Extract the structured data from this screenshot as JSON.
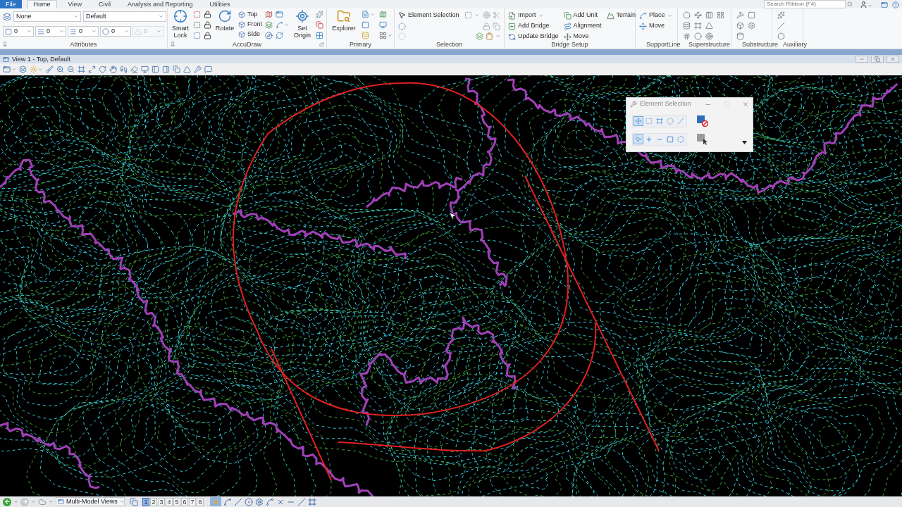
{
  "ribbon_tabs": [
    {
      "label": "File",
      "kind": "backstage",
      "selected": false
    },
    {
      "label": "Home",
      "kind": "tab",
      "selected": true
    },
    {
      "label": "View",
      "kind": "tab",
      "selected": false
    },
    {
      "label": "Civil",
      "kind": "tab",
      "selected": false
    },
    {
      "label": "Analysis and Reporting",
      "kind": "tab",
      "selected": false
    },
    {
      "label": "Utilities",
      "kind": "tab",
      "selected": false
    }
  ],
  "search": {
    "placeholder": "Search Ribbon (F4)"
  },
  "ribbon_groups": [
    {
      "kind": "attributes",
      "title": "Attributes",
      "dropdowns": [
        {
          "value": "None"
        },
        {
          "value": "Default"
        }
      ],
      "fields": [
        {
          "value": "0",
          "disabled": false
        },
        {
          "value": "0",
          "disabled": false
        },
        {
          "value": "0",
          "disabled": false
        },
        {
          "value": "0",
          "disabled": false
        },
        {
          "value": "0",
          "disabled": true
        }
      ]
    },
    {
      "kind": "accudraw",
      "title": "AccuDraw",
      "smart_lock": "Smart Lock",
      "rotate": "Rotate",
      "views": [
        "Top",
        "Front",
        "Side"
      ],
      "set_origin": "Set Origin"
    },
    {
      "kind": "primary",
      "title": "Primary",
      "explorer": "Explorer"
    },
    {
      "kind": "selection",
      "title": "Selection",
      "element_selection": "Element Selection"
    },
    {
      "kind": "bridge_setup",
      "title": "Bridge Setup",
      "columns": [
        {
          "commands": [
            {
              "label": "Import",
              "dropdown": true
            },
            {
              "label": "Add Bridge",
              "dropdown": false
            },
            {
              "label": "Update Bridge",
              "dropdown": false
            }
          ]
        },
        {
          "commands": [
            {
              "label": "Add Unit",
              "dropdown": false
            },
            {
              "label": "Alignment",
              "dropdown": false
            },
            {
              "label": "Move",
              "dropdown": false
            }
          ]
        },
        {
          "commands": [
            {
              "label": "Terrain",
              "dropdown": false
            }
          ]
        }
      ]
    },
    {
      "kind": "supportline",
      "title": "SupportLine",
      "columns": [
        {
          "commands": [
            {
              "label": "Place",
              "dropdown": true
            },
            {
              "label": "Move",
              "dropdown": false
            }
          ]
        }
      ]
    },
    {
      "kind": "superstructure",
      "title": "Superstructure"
    },
    {
      "kind": "substructure",
      "title": "Substructure"
    },
    {
      "kind": "auxiliary",
      "title": "Auxiliary"
    }
  ],
  "view": {
    "title": "View 1 - Top, Default"
  },
  "element_selection_dialog": {
    "title": "Element Selection",
    "methods": [
      {
        "selected": true
      },
      {
        "selected": false
      },
      {
        "selected": false
      },
      {
        "selected": false
      },
      {
        "selected": false
      }
    ],
    "modes": [
      {
        "selected": true
      },
      {
        "selected": false
      },
      {
        "selected": false
      },
      {
        "selected": false
      },
      {
        "selected": false
      }
    ]
  },
  "status_bar": {
    "model_views": "Multi-Model Views",
    "views": [
      {
        "label": "1",
        "selected": true
      },
      {
        "label": "2",
        "selected": false
      },
      {
        "label": "3",
        "selected": false
      },
      {
        "label": "4",
        "selected": false
      },
      {
        "label": "5",
        "selected": false
      },
      {
        "label": "6",
        "selected": false
      },
      {
        "label": "7",
        "selected": false
      },
      {
        "label": "8",
        "selected": false
      }
    ]
  }
}
